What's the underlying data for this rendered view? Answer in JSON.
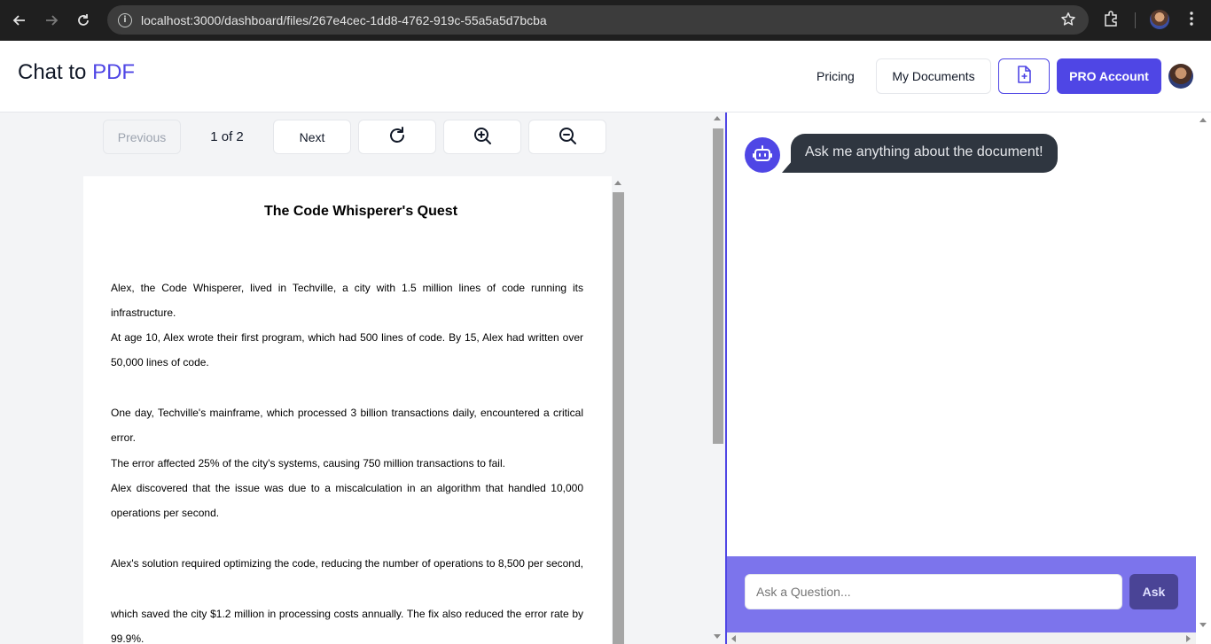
{
  "browser": {
    "url": "localhost:3000/dashboard/files/267e4cec-1dd8-4762-919c-55a5a5d7bcba",
    "icons": [
      "back-icon",
      "forward-icon",
      "reload-icon",
      "info-icon",
      "star-icon",
      "extensions-icon",
      "profile-avatar",
      "more-icon"
    ]
  },
  "header": {
    "logo_prefix": "Chat to",
    "logo_accent": "PDF",
    "pricing": "Pricing",
    "my_documents": "My Documents",
    "upload_icon": "file-plus-icon",
    "pro_account": "PRO Account",
    "accent_color": "#4f46e5"
  },
  "viewer": {
    "previous": "Previous",
    "page_indicator": "1 of 2",
    "next": "Next",
    "rotate_icon": "rotate-icon",
    "zoom_in_icon": "zoom-in-icon",
    "zoom_out_icon": "zoom-out-icon"
  },
  "document": {
    "title": "The Code Whisperer's Quest",
    "lines": [
      "Alex, the Code Whisperer, lived in Techville, a city with 1.5 million lines of code running its",
      "infrastructure.",
      "At age 10, Alex wrote their first program, which had 500 lines of code. By 15, Alex had written over",
      "50,000 lines of code.",
      "One day, Techville's mainframe, which processed 3 billion transactions daily, encountered a critical",
      "error.",
      "The error affected 25% of the city's systems, causing 750 million transactions to fail.",
      "Alex discovered that the issue was due to a miscalculation in an algorithm that handled 10,000",
      "operations per second.",
      "Alex's solution required optimizing the code, reducing the number of operations to 8,500 per second,",
      "which saved the city $1.2 million in processing costs annually. The fix also reduced the error rate by",
      "99.9%."
    ]
  },
  "chat": {
    "bot_icon": "robot-icon",
    "welcome": "Ask me anything about the document!",
    "input_placeholder": "Ask a Question...",
    "ask": "Ask"
  }
}
